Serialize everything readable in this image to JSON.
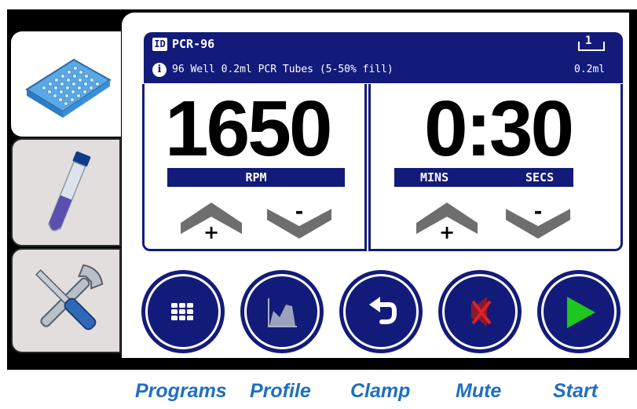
{
  "header": {
    "id_badge": "ID",
    "program_name": "PCR-96",
    "info_icon_glyph": "i",
    "description": "96 Well 0.2ml PCR Tubes (5-50% fill)",
    "volume_index": "1",
    "volume": "0.2ml"
  },
  "tabs": [
    {
      "name": "plate-tab",
      "icon": "well-plate-icon",
      "active": true
    },
    {
      "name": "tube-tab",
      "icon": "test-tube-icon",
      "active": false
    },
    {
      "name": "settings-tab",
      "icon": "wrench-screwdriver-icon",
      "active": false
    }
  ],
  "speed": {
    "value": "1650",
    "unit": "RPM",
    "plus": "+",
    "minus": "-"
  },
  "time": {
    "value": "0:30",
    "mins_label": "MINS",
    "secs_label": "SECS",
    "plus": "+",
    "minus": "-"
  },
  "actions": [
    {
      "label": "Programs",
      "icon": "keypad-icon"
    },
    {
      "label": "Profile",
      "icon": "profile-graph-icon"
    },
    {
      "label": "Clamp",
      "icon": "undo-arrow-icon"
    },
    {
      "label": "Mute",
      "icon": "muted-speaker-icon"
    },
    {
      "label": "Start",
      "icon": "play-icon"
    }
  ],
  "colors": {
    "navy": "#131b7a",
    "caption_blue": "#1f6fbf",
    "play_green": "#1ec81e",
    "mute_red": "#e0202a",
    "tab_grey": "#e2dedd",
    "arrow_grey": "#6e6e6e"
  }
}
